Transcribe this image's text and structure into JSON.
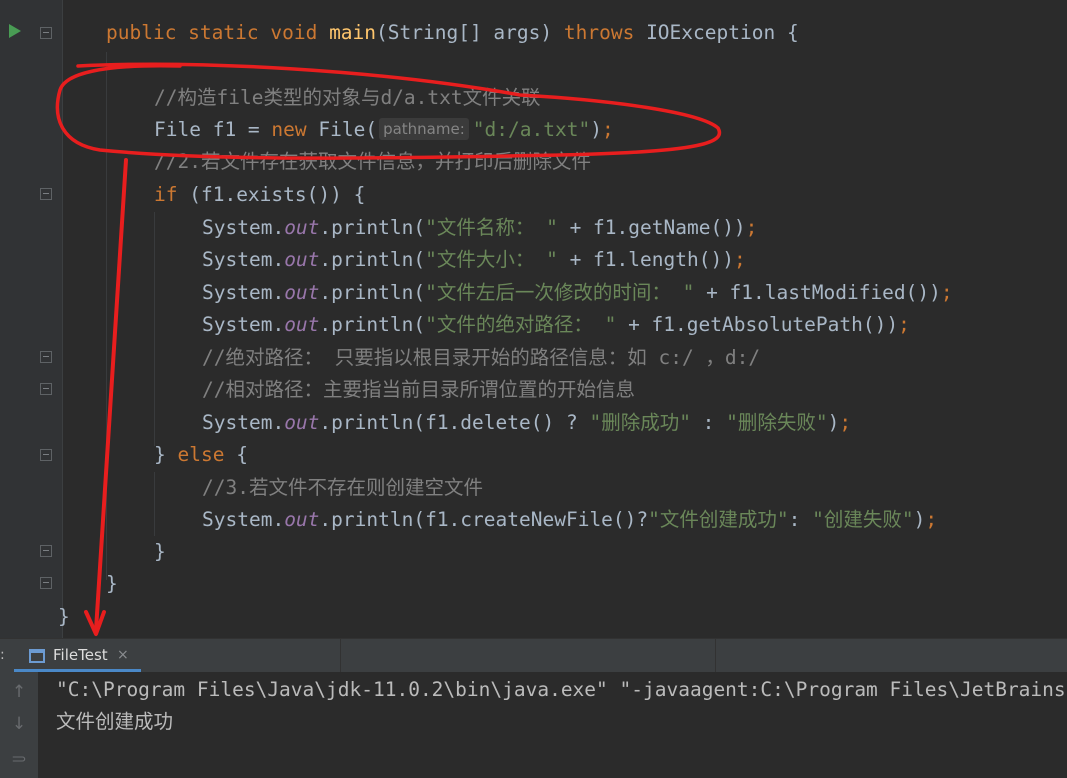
{
  "editor": {
    "lines": [
      {
        "id": "main-signature",
        "tokens": [
          {
            "t": "public static void ",
            "c": "kw"
          },
          {
            "t": "main",
            "c": "fn"
          },
          {
            "t": "(String[] args) ",
            "c": ""
          },
          {
            "t": "throws ",
            "c": "kw"
          },
          {
            "t": "IOException {",
            "c": ""
          }
        ]
      },
      {
        "id": "comment-construct",
        "tokens": [
          {
            "t": "//构造file类型的对象与d/a.txt文件关联",
            "c": "cmt"
          }
        ]
      },
      {
        "id": "file-declaration",
        "tokens": [
          {
            "t": "File f1 = ",
            "c": ""
          },
          {
            "t": "new ",
            "c": "kw"
          },
          {
            "t": "File(",
            "c": ""
          },
          {
            "t": "pathname:",
            "c": "hint"
          },
          {
            "t": "\"d:/a.txt\"",
            "c": "str"
          },
          {
            "t": ")",
            "c": ""
          },
          {
            "t": ";",
            "c": "punc"
          }
        ]
      },
      {
        "id": "comment-step2",
        "tokens": [
          {
            "t": "//2.若文件存在获取文件信息，并打印后删除文件",
            "c": "cmt"
          }
        ]
      },
      {
        "id": "if-exists",
        "tokens": [
          {
            "t": "if ",
            "c": "kw"
          },
          {
            "t": "(f1.exists()) {",
            "c": ""
          }
        ]
      },
      {
        "id": "print-name",
        "tokens": [
          {
            "t": "System.",
            "c": ""
          },
          {
            "t": "out",
            "c": "field"
          },
          {
            "t": ".println(",
            "c": ""
          },
          {
            "t": "\"文件名称： \"",
            "c": "str"
          },
          {
            "t": " + f1.getName())",
            "c": ""
          },
          {
            "t": ";",
            "c": "punc"
          }
        ]
      },
      {
        "id": "print-size",
        "tokens": [
          {
            "t": "System.",
            "c": ""
          },
          {
            "t": "out",
            "c": "field"
          },
          {
            "t": ".println(",
            "c": ""
          },
          {
            "t": "\"文件大小： \"",
            "c": "str"
          },
          {
            "t": " + f1.length())",
            "c": ""
          },
          {
            "t": ";",
            "c": "punc"
          }
        ]
      },
      {
        "id": "print-modified",
        "tokens": [
          {
            "t": "System.",
            "c": ""
          },
          {
            "t": "out",
            "c": "field"
          },
          {
            "t": ".println(",
            "c": ""
          },
          {
            "t": "\"文件左后一次修改的时间： \"",
            "c": "str"
          },
          {
            "t": " + f1.lastModified())",
            "c": ""
          },
          {
            "t": ";",
            "c": "punc"
          }
        ]
      },
      {
        "id": "print-absolute-path",
        "tokens": [
          {
            "t": "System.",
            "c": ""
          },
          {
            "t": "out",
            "c": "field"
          },
          {
            "t": ".println(",
            "c": ""
          },
          {
            "t": "\"文件的绝对路径： \"",
            "c": "str"
          },
          {
            "t": " + f1.getAbsolutePath())",
            "c": ""
          },
          {
            "t": ";",
            "c": "punc"
          }
        ]
      },
      {
        "id": "comment-absolute",
        "tokens": [
          {
            "t": "//绝对路径： 只要指以根目录开始的路径信息：如 c:/ ，d:/",
            "c": "cmt"
          }
        ]
      },
      {
        "id": "comment-relative",
        "tokens": [
          {
            "t": "//相对路径：主要指当前目录所谓位置的开始信息",
            "c": "cmt"
          }
        ]
      },
      {
        "id": "print-delete",
        "tokens": [
          {
            "t": "System.",
            "c": ""
          },
          {
            "t": "out",
            "c": "field"
          },
          {
            "t": ".println(f1.delete() ? ",
            "c": ""
          },
          {
            "t": "\"删除成功\"",
            "c": "str"
          },
          {
            "t": " : ",
            "c": ""
          },
          {
            "t": "\"删除失败\"",
            "c": "str"
          },
          {
            "t": ")",
            "c": ""
          },
          {
            "t": ";",
            "c": "punc"
          }
        ]
      },
      {
        "id": "else-branch",
        "tokens": [
          {
            "t": "} ",
            "c": ""
          },
          {
            "t": "else ",
            "c": "kw"
          },
          {
            "t": "{",
            "c": ""
          }
        ]
      },
      {
        "id": "comment-step3",
        "tokens": [
          {
            "t": "//3.若文件不存在则创建空文件",
            "c": "cmt"
          }
        ]
      },
      {
        "id": "print-create",
        "tokens": [
          {
            "t": "System.",
            "c": ""
          },
          {
            "t": "out",
            "c": "field"
          },
          {
            "t": ".println(f1.createNewFile()?",
            "c": ""
          },
          {
            "t": "\"文件创建成功\"",
            "c": "str"
          },
          {
            "t": ": ",
            "c": ""
          },
          {
            "t": "\"创建失败\"",
            "c": "str"
          },
          {
            "t": ")",
            "c": ""
          },
          {
            "t": ";",
            "c": "punc"
          }
        ]
      },
      {
        "id": "close-else",
        "tokens": [
          {
            "t": "}",
            "c": ""
          }
        ]
      },
      {
        "id": "close-method",
        "tokens": [
          {
            "t": "}",
            "c": ""
          }
        ]
      },
      {
        "id": "close-class",
        "tokens": [
          {
            "t": "}",
            "c": ""
          }
        ]
      }
    ]
  },
  "run_panel": {
    "tab_prefix": ":",
    "tab_label": "FileTest",
    "tab_close": "×",
    "toolbar_icons": [
      {
        "name": "scroll-up-arrow-icon",
        "glyph": "↑"
      },
      {
        "name": "scroll-down-arrow-icon",
        "glyph": "↓"
      },
      {
        "name": "soft-wrap-icon",
        "glyph": "⥰"
      }
    ],
    "console_lines": [
      "\"C:\\Program Files\\Java\\jdk-11.0.2\\bin\\java.exe\" \"-javaagent:C:\\Program Files\\JetBrains",
      "文件创建成功"
    ]
  },
  "colors": {
    "editor_bg": "#2b2b2b",
    "keyword": "#cc7832",
    "method": "#ffc66d",
    "string": "#6a8759",
    "comment": "#808080",
    "field": "#9876aa",
    "annotation_red": "#e81e1e"
  }
}
